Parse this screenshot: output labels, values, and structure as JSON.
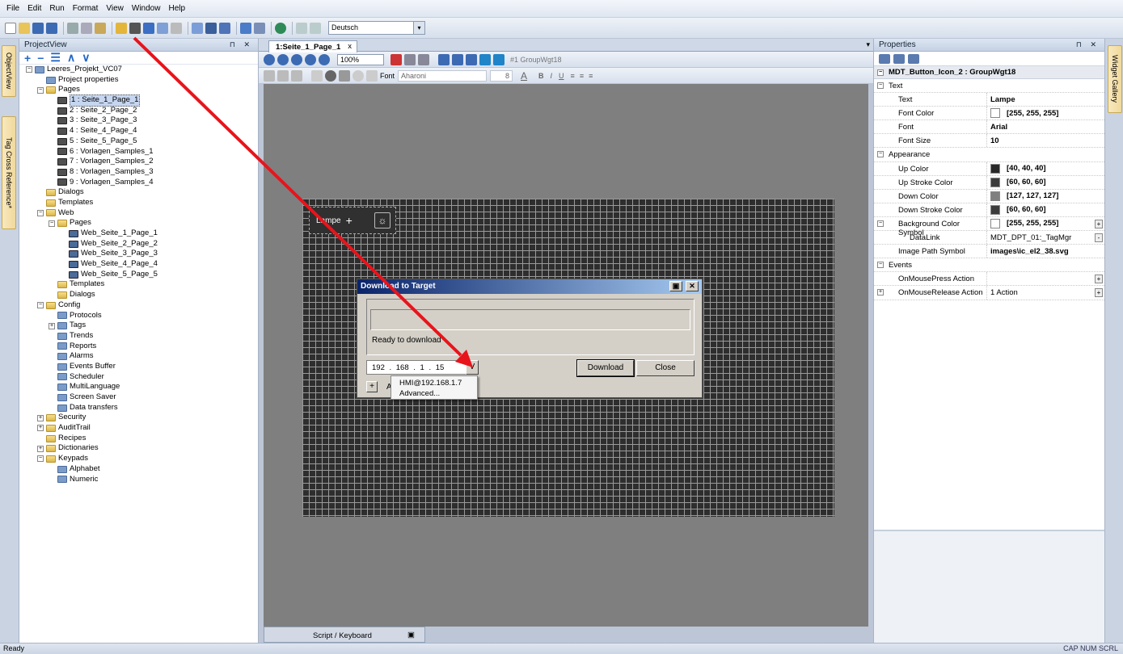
{
  "menu": [
    "File",
    "Edit",
    "Run",
    "Format",
    "View",
    "Window",
    "Help"
  ],
  "toolbar": {
    "language": "Deutsch"
  },
  "left_tabs": [
    "ObjectView",
    "Tag Cross Reference*"
  ],
  "right_tabs": [
    "Widget Gallery"
  ],
  "project": {
    "title": "ProjectView",
    "tools": [
      "+",
      "−",
      "☰",
      "∧",
      "∨"
    ],
    "tree": [
      {
        "label": "Leeres_Projekt_VC07",
        "depth": 0,
        "icon": "gen",
        "exp": "−"
      },
      {
        "label": "Project properties",
        "depth": 1,
        "icon": "gen"
      },
      {
        "label": "Pages",
        "depth": 1,
        "icon": "folder",
        "exp": "−"
      },
      {
        "label": "1 : Seite_1_Page_1",
        "depth": 2,
        "icon": "page",
        "sel": true
      },
      {
        "label": "2 : Seite_2_Page_2",
        "depth": 2,
        "icon": "page"
      },
      {
        "label": "3 : Seite_3_Page_3",
        "depth": 2,
        "icon": "page"
      },
      {
        "label": "4 : Seite_4_Page_4",
        "depth": 2,
        "icon": "page"
      },
      {
        "label": "5 : Seite_5_Page_5",
        "depth": 2,
        "icon": "page"
      },
      {
        "label": "6 : Vorlagen_Samples_1",
        "depth": 2,
        "icon": "page"
      },
      {
        "label": "7 : Vorlagen_Samples_2",
        "depth": 2,
        "icon": "page"
      },
      {
        "label": "8 : Vorlagen_Samples_3",
        "depth": 2,
        "icon": "page"
      },
      {
        "label": "9 : Vorlagen_Samples_4",
        "depth": 2,
        "icon": "page"
      },
      {
        "label": "Dialogs",
        "depth": 1,
        "icon": "folder"
      },
      {
        "label": "Templates",
        "depth": 1,
        "icon": "folder"
      },
      {
        "label": "Web",
        "depth": 1,
        "icon": "folder",
        "exp": "−"
      },
      {
        "label": "Pages",
        "depth": 2,
        "icon": "folder",
        "exp": "−"
      },
      {
        "label": "Web_Seite_1_Page_1",
        "depth": 3,
        "icon": "web"
      },
      {
        "label": "Web_Seite_2_Page_2",
        "depth": 3,
        "icon": "web"
      },
      {
        "label": "Web_Seite_3_Page_3",
        "depth": 3,
        "icon": "web"
      },
      {
        "label": "Web_Seite_4_Page_4",
        "depth": 3,
        "icon": "web"
      },
      {
        "label": "Web_Seite_5_Page_5",
        "depth": 3,
        "icon": "web"
      },
      {
        "label": "Templates",
        "depth": 2,
        "icon": "folder"
      },
      {
        "label": "Dialogs",
        "depth": 2,
        "icon": "folder"
      },
      {
        "label": "Config",
        "depth": 1,
        "icon": "folder",
        "exp": "−"
      },
      {
        "label": "Protocols",
        "depth": 2,
        "icon": "gen"
      },
      {
        "label": "Tags",
        "depth": 2,
        "icon": "gen",
        "exp": "+"
      },
      {
        "label": "Trends",
        "depth": 2,
        "icon": "gen"
      },
      {
        "label": "Reports",
        "depth": 2,
        "icon": "gen"
      },
      {
        "label": "Alarms",
        "depth": 2,
        "icon": "gen"
      },
      {
        "label": "Events Buffer",
        "depth": 2,
        "icon": "gen"
      },
      {
        "label": "Scheduler",
        "depth": 2,
        "icon": "gen"
      },
      {
        "label": "MultiLanguage",
        "depth": 2,
        "icon": "gen"
      },
      {
        "label": "Screen Saver",
        "depth": 2,
        "icon": "gen"
      },
      {
        "label": "Data transfers",
        "depth": 2,
        "icon": "gen"
      },
      {
        "label": "Security",
        "depth": 1,
        "icon": "folder",
        "exp": "+"
      },
      {
        "label": "AuditTrail",
        "depth": 1,
        "icon": "folder",
        "exp": "+"
      },
      {
        "label": "Recipes",
        "depth": 1,
        "icon": "folder"
      },
      {
        "label": "Dictionaries",
        "depth": 1,
        "icon": "folder",
        "exp": "+"
      },
      {
        "label": "Keypads",
        "depth": 1,
        "icon": "folder",
        "exp": "−"
      },
      {
        "label": "Alphabet",
        "depth": 2,
        "icon": "gen"
      },
      {
        "label": "Numeric",
        "depth": 2,
        "icon": "gen"
      }
    ]
  },
  "editor": {
    "tab": "1:Seite_1_Page_1",
    "tab_close": "x",
    "zoom": "100%",
    "group_label": "#1 GroupWgt18",
    "font_label": "Font",
    "font_value": "Aharoni",
    "font_size": "8",
    "widget_text": "Lampe",
    "widget_plus": "+",
    "script_tab": "Script / Keyboard"
  },
  "dialog": {
    "title": "Download to Target",
    "status": "Ready to download",
    "ip": "192 . 168 . 1 . 15",
    "ip_btn": "V",
    "download": "Download",
    "close": "Close",
    "plus": "+",
    "a": "A",
    "menu_items": [
      "HMI@192.168.1.7",
      "Advanced..."
    ]
  },
  "props": {
    "title": "Properties",
    "object": "MDT_Button_Icon_2 : GroupWgt18",
    "rows": [
      {
        "type": "cat",
        "k": "Text"
      },
      {
        "k": "Text",
        "v": "Lampe"
      },
      {
        "k": "Font Color",
        "v": "[255, 255, 255]",
        "sw": "#ffffff"
      },
      {
        "k": "Font",
        "v": "Arial"
      },
      {
        "k": "Font Size",
        "v": "10"
      },
      {
        "type": "cat",
        "k": "Appearance"
      },
      {
        "k": "Up Color",
        "v": "[40, 40, 40]",
        "sw": "#282828"
      },
      {
        "k": "Up Stroke Color",
        "v": "[60, 60, 60]",
        "sw": "#3c3c3c"
      },
      {
        "k": "Down Color",
        "v": "[127, 127, 127]",
        "sw": "#7f7f7f"
      },
      {
        "k": "Down Stroke Color",
        "v": "[60, 60, 60]",
        "sw": "#3c3c3c"
      },
      {
        "k": "Background Color Symbol",
        "v": "[255, 255, 255]",
        "sw": "#ffffff",
        "exp": "−",
        "btn": "+"
      },
      {
        "k": "DataLink",
        "v": "MDT_DPT_01:_TagMgr",
        "norm": true,
        "btn": "-",
        "indent": true
      },
      {
        "k": "Image Path Symbol",
        "v": "images\\ic_el2_38.svg"
      },
      {
        "type": "cat",
        "k": "Events"
      },
      {
        "k": "OnMousePress Action",
        "v": "",
        "btn": "+"
      },
      {
        "k": "OnMouseRelease Action",
        "v": "1 Action",
        "norm": true,
        "btn": "+",
        "exp": "+"
      }
    ]
  },
  "status": {
    "left": "Ready",
    "right": "CAP  NUM  SCRL"
  }
}
